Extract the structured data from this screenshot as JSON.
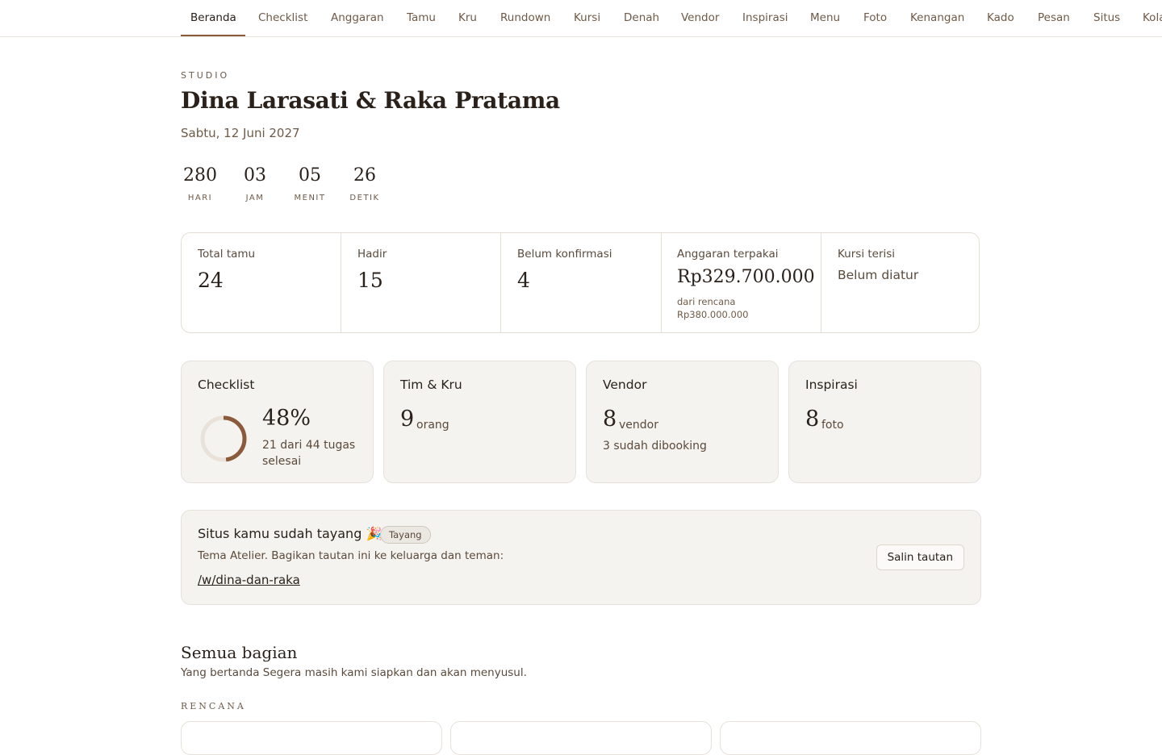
{
  "nav": {
    "tabs": [
      "Beranda",
      "Checklist",
      "Anggaran",
      "Tamu",
      "Kru",
      "Rundown",
      "Kursi",
      "Denah",
      "Vendor",
      "Inspirasi",
      "Menu",
      "Foto",
      "Kenangan",
      "Kado",
      "Pesan",
      "Situs",
      "Kola"
    ],
    "active": "Beranda"
  },
  "header": {
    "eyebrow": "STUDIO",
    "title": "Dina Larasati & Raka Pratama",
    "date": "Sabtu, 12 Juni 2027"
  },
  "countdown": [
    {
      "value": "280",
      "label": "HARI"
    },
    {
      "value": "03",
      "label": "JAM"
    },
    {
      "value": "05",
      "label": "MENIT"
    },
    {
      "value": "26",
      "label": "DETIK"
    }
  ],
  "stats": {
    "total_guests": {
      "label": "Total tamu",
      "value": "24"
    },
    "attending": {
      "label": "Hadir",
      "value": "15"
    },
    "unconfirmed": {
      "label": "Belum konfirmasi",
      "value": "4"
    },
    "budget": {
      "label": "Anggaran terpakai",
      "value": "Rp329.700.000",
      "note_line1": "dari rencana",
      "note_line2": "Rp380.000.000"
    },
    "seats": {
      "label": "Kursi terisi",
      "value": "Belum diatur"
    }
  },
  "cards": {
    "checklist": {
      "title": "Checklist",
      "percent_text": "48%",
      "progress": 0.48,
      "sub_line1": "21 dari 44 tugas",
      "sub_line2": "selesai"
    },
    "team": {
      "title": "Tim & Kru",
      "value": "9",
      "unit": "orang"
    },
    "vendor": {
      "title": "Vendor",
      "value": "8",
      "unit": "vendor",
      "sub": "3 sudah dibooking"
    },
    "inspiration": {
      "title": "Inspirasi",
      "value": "8",
      "unit": "foto"
    }
  },
  "site": {
    "title": "Situs kamu sudah tayang 🎉",
    "badge": "Tayang",
    "description": "Tema Atelier. Bagikan tautan ini ke keluarga dan teman:",
    "link": "/w/dina-dan-raka",
    "copy_button": "Salin tautan"
  },
  "sections": {
    "title": "Semua bagian",
    "subtitle": "Yang bertanda Segera masih kami siapkan dan akan menyusul.",
    "group_label": "RENCANA"
  },
  "colors": {
    "accent": "#8a5a3b",
    "ring_track": "#e8e2da",
    "card_bg": "#f5f3ef"
  }
}
